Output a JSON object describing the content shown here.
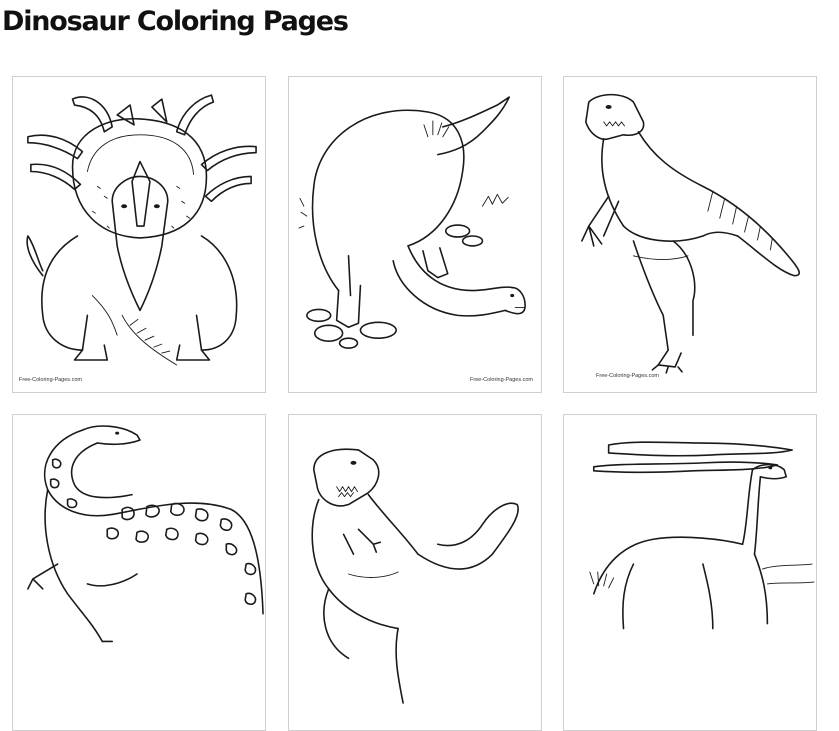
{
  "page": {
    "title": "Dinosaur Coloring Pages"
  },
  "gallery": {
    "items": [
      {
        "subject": "styracosaurus",
        "credit": "Free-Coloring-Pages.com"
      },
      {
        "subject": "brachiosaurus-grazing",
        "credit": "Free-Coloring-Pages.com"
      },
      {
        "subject": "allosaurus",
        "credit": "Free-Coloring-Pages.com"
      },
      {
        "subject": "spotted-sauropod",
        "credit": ""
      },
      {
        "subject": "tyrannosaurus",
        "credit": ""
      },
      {
        "subject": "brachiosaurus-landscape",
        "credit": ""
      }
    ]
  },
  "colors": {
    "ink": "#1a1a1a",
    "card_border": "#cfcfcf",
    "background": "#ffffff"
  }
}
